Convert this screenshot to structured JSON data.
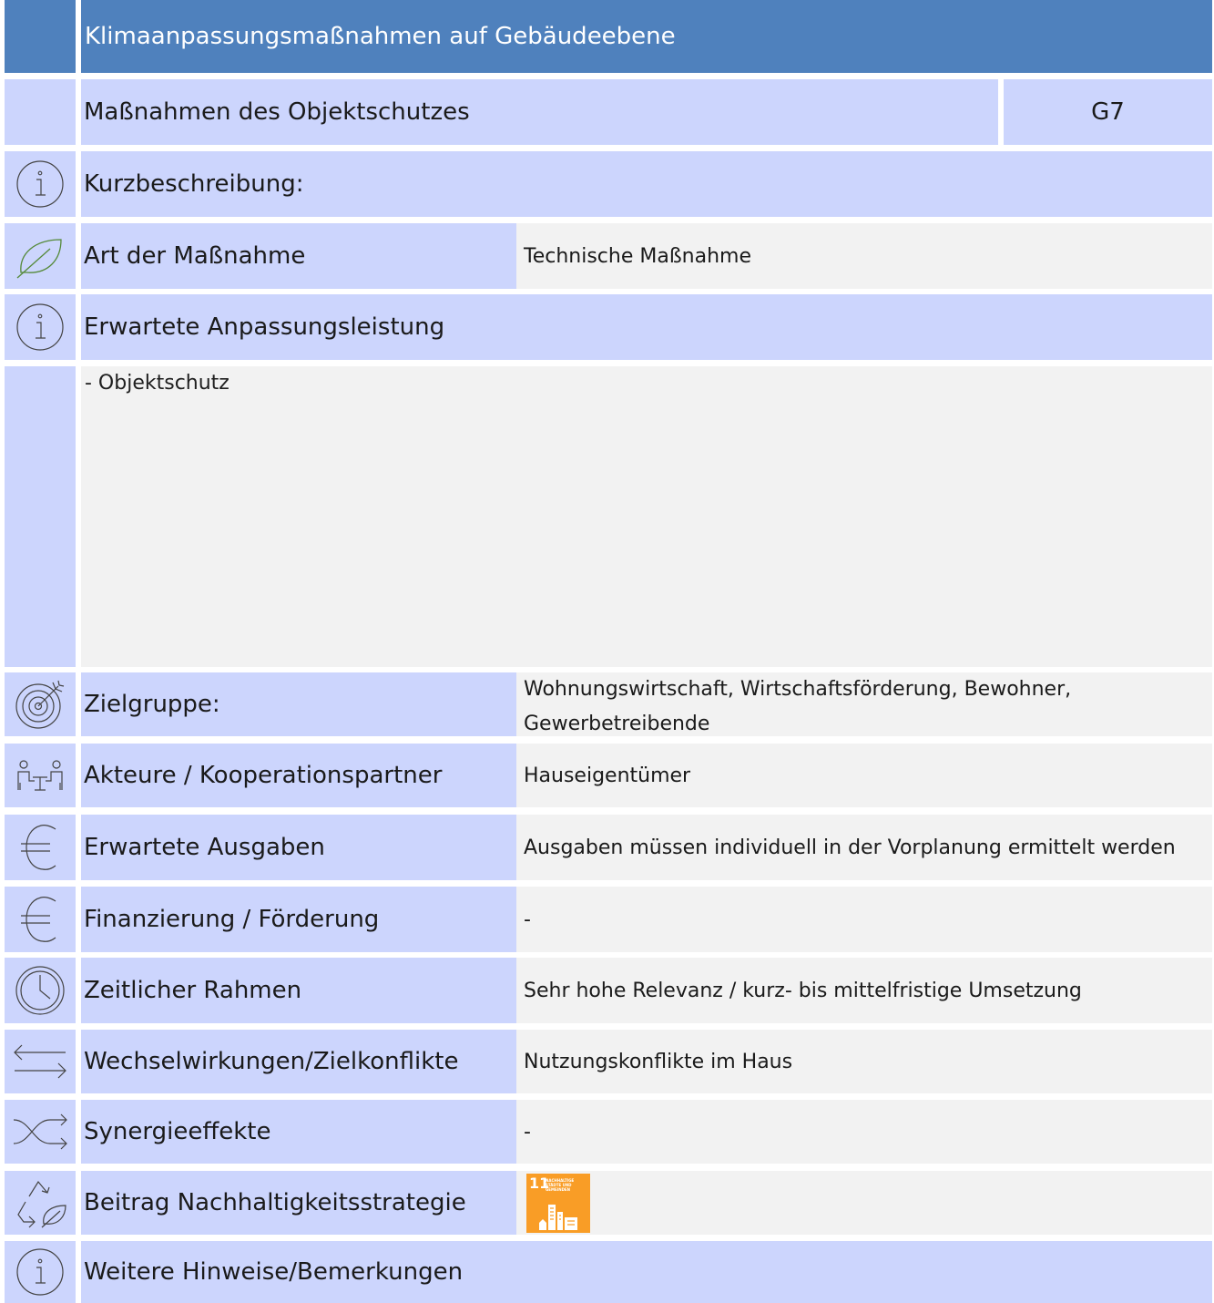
{
  "header": {
    "title": "Klimaanpassungsmaßnahmen auf Gebäudeebene"
  },
  "measure": {
    "title": "Maßnahmen des Objektschutzes",
    "code": "G7"
  },
  "short_description": {
    "label": "Kurzbeschreibung:",
    "icon": "info-icon"
  },
  "type": {
    "label": "Art der Maßnahme",
    "value": "Technische Maßnahme",
    "icon": "leaf-icon"
  },
  "performance": {
    "label": "Erwartete Anpassungsleistung",
    "icon": "info-icon",
    "text": "- Objektschutz"
  },
  "target_group": {
    "label": "Zielgruppe:",
    "icon": "target-icon",
    "line1": "Wohnungswirtschaft, Wirtschaftsförderung, Bewohner,",
    "line2": "Gewerbetreibende"
  },
  "actors": {
    "label": "Akteure / Kooperationspartner",
    "value": "Hauseigentümer",
    "icon": "meeting-people-icon"
  },
  "expenses": {
    "label": "Erwartete Ausgaben",
    "value": "Ausgaben müssen individuell in der Vorplanung ermittelt werden",
    "icon": "euro-icon"
  },
  "funding": {
    "label": "Finanzierung / Förderung",
    "value": "-",
    "icon": "euro-icon"
  },
  "timeframe": {
    "label": "Zeitlicher Rahmen",
    "value": "Sehr hohe Relevanz / kurz- bis mittelfristige Umsetzung",
    "icon": "clock-icon"
  },
  "interactions": {
    "label": "Wechselwirkungen/Zielkonflikte",
    "value": "Nutzungskonflikte im Haus",
    "icon": "arrows-exchange-icon"
  },
  "synergies": {
    "label": "Synergieeffekte",
    "value": "-",
    "icon": "shuffle-icon"
  },
  "sustainability": {
    "label": "Beitrag Nachhaltigkeitsstrategie",
    "icon": "recycle-leaf-icon",
    "sdg_number": "11",
    "sdg_text": "NACHHALTIGE STÄDTE UND GEMEINDEN"
  },
  "remarks": {
    "label": "Weitere Hinweise/Bemerkungen",
    "icon": "info-icon"
  },
  "colors": {
    "header": "#4f81bd",
    "label_bg": "#ccd5fd",
    "value_bg": "#f2f2f2",
    "sdg": "#f99d26"
  }
}
